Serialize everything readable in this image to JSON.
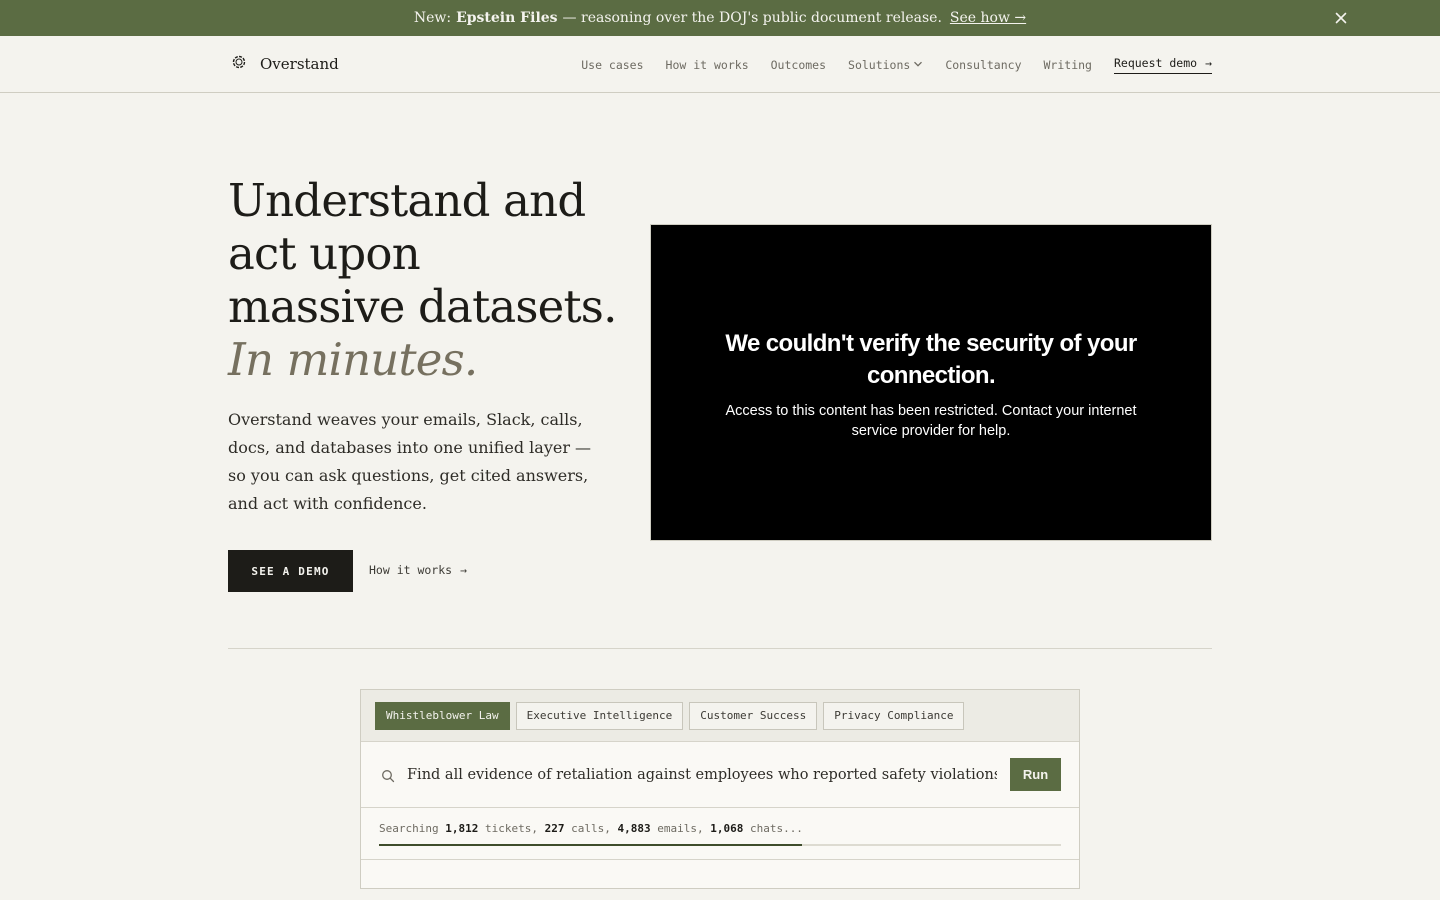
{
  "banner": {
    "prefix": "New:",
    "highlight": "Epstein Files",
    "text": "— reasoning over the DOJ's public document release.",
    "link": "See how →",
    "close_icon": "close-icon"
  },
  "header": {
    "brand": "Overstand",
    "logo_icon": "logo-ring-icon",
    "nav": {
      "use_cases": "Use cases",
      "how_it_works": "How it works",
      "outcomes": "Outcomes",
      "solutions": "Solutions",
      "consultancy": "Consultancy",
      "writing": "Writing",
      "request_demo": "Request demo",
      "request_demo_arrow": "→"
    }
  },
  "hero": {
    "title_lines": [
      "Understand and",
      "act upon",
      "massive datasets."
    ],
    "title_accent": "In minutes.",
    "description": "Overstand weaves your emails, Slack, calls, docs, and databases into one unified layer — so you can ask questions, get cited answers, and act with confidence.",
    "primary_cta": "SEE A DEMO",
    "secondary_cta": "How it works",
    "secondary_arrow": "→"
  },
  "media_error": {
    "title": "We couldn't verify the security of your connection.",
    "message": "Access to this content has been restricted. Contact your internet service provider for help."
  },
  "demo": {
    "tabs": [
      "Whistleblower Law",
      "Executive Intelligence",
      "Customer Success",
      "Privacy Compliance"
    ],
    "active_tab": "Whistleblower Law",
    "query": "Find all evidence of retaliation against employees who reported safety violations",
    "run_label": "Run",
    "status": {
      "prefix": "Searching",
      "tickets_count": "1,812",
      "tickets_label": "tickets,",
      "calls_count": "227",
      "calls_label": "calls,",
      "emails_count": "4,883",
      "emails_label": "emails,",
      "chats_count": "1,068",
      "chats_label": "chats..."
    },
    "progress": 0.62
  },
  "colors": {
    "accent": "#5b6c43",
    "background": "#f4f3ee",
    "text": "#1d1c18"
  }
}
